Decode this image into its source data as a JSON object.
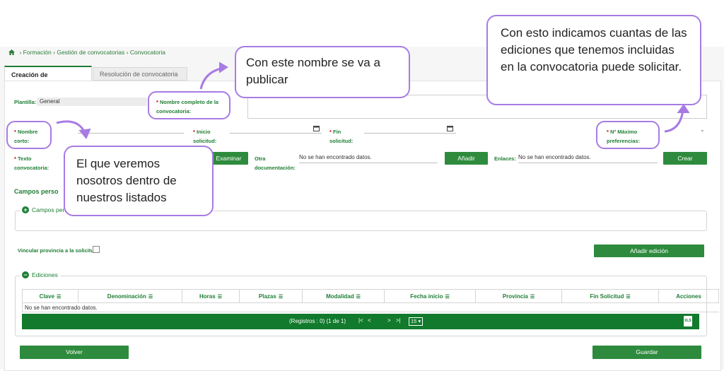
{
  "breadcrumb": {
    "items": [
      "Formación",
      "Gestión de convocatorias",
      "Convocatoria"
    ],
    "separator": "›"
  },
  "tabs": [
    {
      "label": "Creación de convocatoria",
      "active": true
    },
    {
      "label": "Resolución de convocatoria",
      "active": false
    }
  ],
  "form": {
    "plantilla_label": "Plantilla:",
    "plantilla_value": "General",
    "nombre_completo_label": "Nombre completo de la convocatoria:",
    "nombre_corto_label": "Nombre corto:",
    "inicio_label": "Inicio solicitud:",
    "fin_label": "Fin solicitud:",
    "max_pref_label": "Nº Máximo preferencias:",
    "texto_label": "Texto convocatoria:",
    "examinar_button": "Examinar",
    "otra_doc_label": "Otra documentación:",
    "otra_doc_value": "No se han encontrado datos.",
    "anadir_button": "Añadir",
    "enlaces_label": "Enlaces:",
    "enlaces_value": "No se han encontrado datos.",
    "crear_button": "Crear",
    "required_mark": "*"
  },
  "campos": {
    "section_title": "Campos perso",
    "fieldset_legend": "Campos pers"
  },
  "vincular_label": "Vincular provincia a la solicitud",
  "anadir_edicion_button": "Añadir edición",
  "ediciones": {
    "legend": "Ediciones",
    "columns": [
      "Clave",
      "Denominación",
      "Horas",
      "Plazas",
      "Modalidad",
      "Fecha inicio",
      "Provincia",
      "Fin Solicitud",
      "Acciones"
    ],
    "empty_text": "No se han encontrado datos.",
    "pager_text": "(Registros : 0) (1 de 1)",
    "page_size": "15",
    "export_icon_text": "XLS"
  },
  "footer": {
    "volver_button": "Volver",
    "guardar_button": "Guardar"
  },
  "annotations": {
    "publish": "Con este nombre se va a publicar",
    "short": "El que veremos nosotros dentro de nuestros listados",
    "editions": "Con esto indicamos cuantas de las ediciones que tenemos incluidas en la convocatoria puede solicitar."
  },
  "colors": {
    "primary_green": "#2e8b3d",
    "pager_green": "#117a2c",
    "annotation_purple": "#a77be3"
  }
}
